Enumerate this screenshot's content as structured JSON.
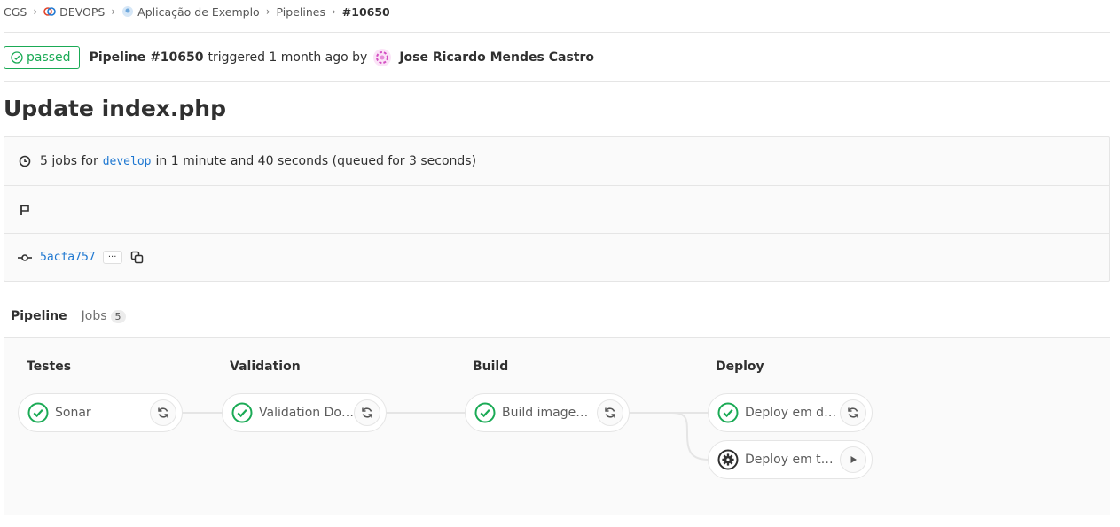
{
  "breadcrumb": {
    "items": [
      "CGS",
      "DEVOPS",
      "Aplicação de Exemplo",
      "Pipelines"
    ],
    "current": "#10650"
  },
  "header": {
    "status": "passed",
    "pipeline_label": "Pipeline #10650",
    "triggered_text": "triggered 1 month ago by",
    "author": "Jose Ricardo Mendes Castro"
  },
  "title": "Update index.php",
  "info": {
    "jobs_prefix": "5 jobs for",
    "branch": "develop",
    "jobs_suffix": "in 1 minute and 40 seconds (queued for 3 seconds)",
    "commit_sha": "5acfa757",
    "ellipsis": "···"
  },
  "tabs": [
    {
      "label": "Pipeline"
    },
    {
      "label": "Jobs",
      "count": "5"
    }
  ],
  "stages": [
    {
      "title": "Testes",
      "jobs": [
        {
          "name": "Sonar",
          "status": "success",
          "action": "retry"
        }
      ]
    },
    {
      "title": "Validation",
      "jobs": [
        {
          "name": "Validation Dock...",
          "status": "success",
          "action": "retry"
        }
      ]
    },
    {
      "title": "Build",
      "jobs": [
        {
          "name": "Build imagem b...",
          "status": "success",
          "action": "retry"
        }
      ]
    },
    {
      "title": "Deploy",
      "jobs": [
        {
          "name": "Deploy em dese...",
          "status": "success",
          "action": "retry"
        },
        {
          "name": "Deploy em teste...",
          "status": "manual",
          "action": "play"
        }
      ]
    }
  ],
  "colors": {
    "success": "#1aaa55",
    "link": "#1f78d1",
    "text": "#303030"
  }
}
